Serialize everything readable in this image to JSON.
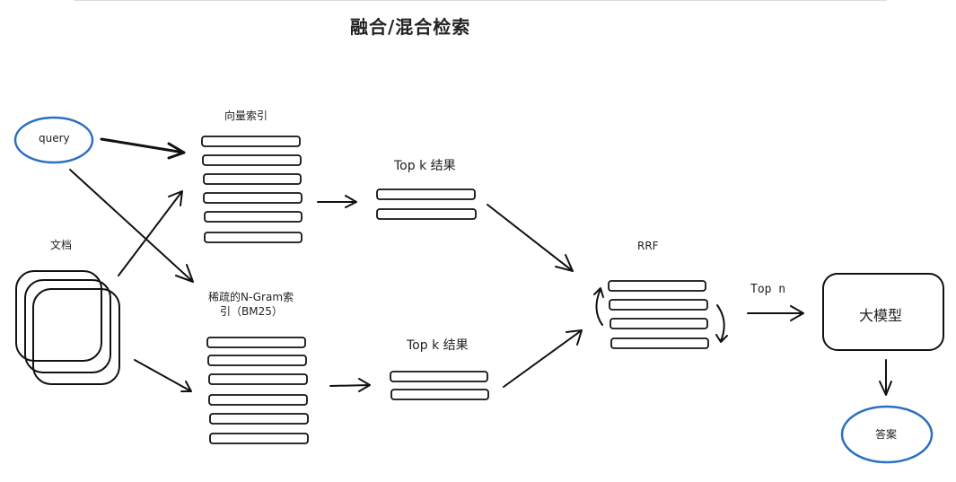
{
  "title": "融合/混合检索",
  "nodes": {
    "query": "query",
    "documents": "文档",
    "vector_index": "向量索引",
    "sparse_index_line1": "稀疏的N-Gram索",
    "sparse_index_line2": "引（BM25）",
    "topk_upper": "Top k 结果",
    "topk_lower": "Top k 结果",
    "rrf": "RRF",
    "top_n": "Top n",
    "llm": "大模型",
    "answer": "答案"
  },
  "list_counts": {
    "vector_index_rows": 6,
    "sparse_index_rows": 6,
    "topk_upper_rows": 2,
    "topk_lower_rows": 2,
    "rrf_rows": 4
  },
  "colors": {
    "ellipse_stroke": "#2a6fc4",
    "line": "#111111"
  }
}
